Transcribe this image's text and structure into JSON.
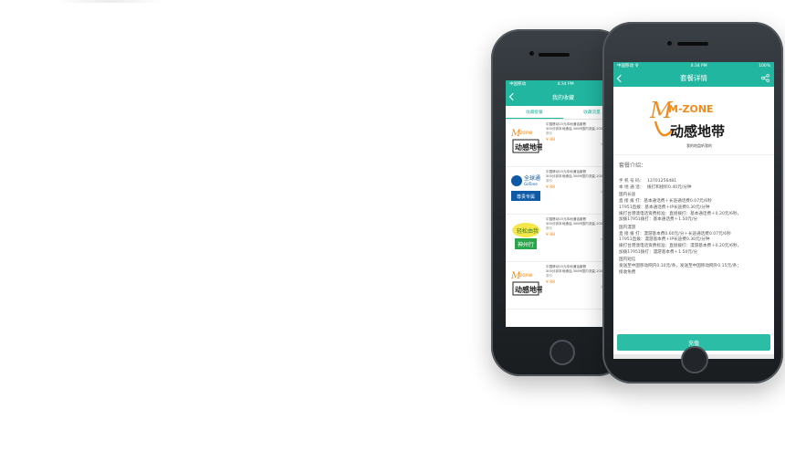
{
  "front": {
    "status": {
      "carrier": "中国移动 令",
      "time": "4:34 PM",
      "battery": "100%"
    },
    "nav_title": "套餐详情",
    "brand_logo_text": "M-ZONE",
    "brand_cn": "动感地带",
    "brand_slogan": "我的地盘听我的",
    "intro_title": "套餐介绍：",
    "phone_label": "手 机 号 码：",
    "phone_value": "13701256481",
    "plan_label": "本 地 通 话：",
    "plan_value": "拨打和接听0.40元/分钟",
    "domestic_title": "国内长途",
    "domestic_line1": "直 接 拨 打：基本通话费＋长途通话费0.07元/6秒",
    "domestic_line2": "17951直拨：基本通话费＋IP长途费0.30元/分钟",
    "domestic_line3": "拨打台港澳电话资费标准：直接拨打：基本通话费＋0.20元/6秒，",
    "domestic_line4": "加拨17951拨打：基本通话费＋1.50元/分",
    "roaming_title": "国内漫游",
    "roaming_line1": "直 接 拨 打：漫游基本费0.60元/分＋长途通话费0.07元/6秒",
    "roaming_line2": "17951直拨：漫游基本费＋IP长途费0.30元/分钟",
    "roaming_line3": "拨打台港澳电话资费标准：直接拨打：漫游基本费＋0.20元/6秒，",
    "roaming_line4": "加拨17951拨打：漫游基本费＋1.50元/分",
    "sms_title": "国内短信",
    "sms_line1": "发送至中国移动网内0.10元/条，发送至中国移动网外0.15元/条；",
    "sms_line2": "接收免费",
    "charge_button": "充值"
  },
  "back": {
    "status": {
      "carrier": "中国移动",
      "time": "4:34 PM",
      "battery": "100%"
    },
    "nav_title": "我的收藏",
    "tab1": "收藏套餐",
    "tab2": "收藏流量",
    "items": [
      {
        "logo": "动感地带",
        "title": "中国移动15元本地通话套餐",
        "desc": "300分钟本地通话,300M国内流量,100条短信",
        "sub": "原价",
        "price": "¥ 88",
        "meta": "4 已有人收藏",
        "kind": "mzone"
      },
      {
        "logo": "全球通",
        "title": "中国移动15元本地通话套餐",
        "desc": "300分钟本地通话,300M国内流量,100条短信",
        "sub": "原价",
        "price": "¥ 88",
        "meta": "4 已有人收藏",
        "kind": "gotone"
      },
      {
        "logo": "神州行",
        "title": "中国移动15元本地通话套餐",
        "desc": "300分钟本地通话,300M国内流量,100条短信",
        "sub": "原价",
        "price": "¥ 88",
        "meta": "4 已有人收藏",
        "kind": "szx"
      },
      {
        "logo": "动感地带",
        "title": "中国移动15元本地通话套餐",
        "desc": "300分钟本地通话,300M国内流量,100条短信",
        "sub": "原价",
        "price": "¥ 88",
        "meta": "4 已有人收藏",
        "kind": "mzone"
      }
    ]
  },
  "colors": {
    "accent": "#21b6a0",
    "price": "#f18c1e",
    "brand_orange": "#f08c1f"
  }
}
